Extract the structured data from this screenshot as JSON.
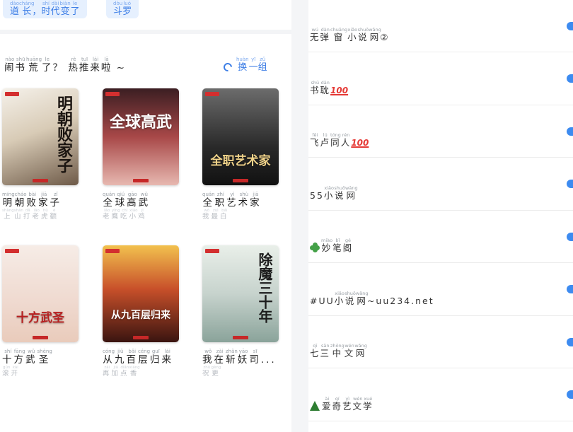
{
  "left": {
    "chips": [
      {
        "chars": [
          {
            "c": "道",
            "p": "dào"
          },
          {
            "c": "长",
            "p": "cháng"
          },
          {
            "c": "，",
            "p": ""
          },
          {
            "c": "时",
            "p": "shí"
          },
          {
            "c": "代",
            "p": "dài"
          },
          {
            "c": "变",
            "p": "biàn"
          },
          {
            "c": "了",
            "p": "le"
          }
        ]
      },
      {
        "chars": [
          {
            "c": "斗",
            "p": "dòu"
          },
          {
            "c": "罗",
            "p": "luó"
          }
        ]
      }
    ],
    "section_title": [
      {
        "c": "闹",
        "p": "nào"
      },
      {
        "c": "书",
        "p": "shū"
      },
      {
        "c": "荒",
        "p": "huāng"
      },
      {
        "c": "了",
        "p": "le"
      },
      {
        "c": "？",
        "p": ""
      },
      {
        "c": " ",
        "p": ""
      },
      {
        "c": "热",
        "p": "rè"
      },
      {
        "c": "推",
        "p": "tuī"
      },
      {
        "c": "来",
        "p": "lái"
      },
      {
        "c": "啦",
        "p": "lā"
      },
      {
        "c": " ~",
        "p": ""
      }
    ],
    "refresh": [
      {
        "c": "换",
        "p": "huàn"
      },
      {
        "c": "一",
        "p": "yī"
      },
      {
        "c": "组",
        "p": "zǔ"
      }
    ],
    "books": [
      {
        "name": [
          {
            "c": "明",
            "p": "míng"
          },
          {
            "c": "朝",
            "p": "cháo"
          },
          {
            "c": "败",
            "p": "bài"
          },
          {
            "c": "家",
            "p": "jiā"
          },
          {
            "c": "子",
            "p": "zǐ"
          }
        ],
        "author": [
          {
            "c": "上",
            "p": "shàng"
          },
          {
            "c": "山",
            "p": "shān"
          },
          {
            "c": "打",
            "p": "dǎ"
          },
          {
            "c": "老",
            "p": "lǎo"
          },
          {
            "c": "虎",
            "p": "hǔ"
          },
          {
            "c": "额",
            "p": "é"
          }
        ],
        "cover_text": "明朝败家子",
        "bg": "linear-gradient(160deg,#f5f1ea 0%,#d8cbb6 45%,#6e5a48 100%)",
        "fg": "#1a1410"
      },
      {
        "name": [
          {
            "c": "全",
            "p": "quán"
          },
          {
            "c": "球",
            "p": "qiú"
          },
          {
            "c": "高",
            "p": "gāo"
          },
          {
            "c": "武",
            "p": "wǔ"
          }
        ],
        "author": [
          {
            "c": "老",
            "p": "lǎo"
          },
          {
            "c": "鹰",
            "p": "yīng"
          },
          {
            "c": "吃",
            "p": "chī"
          },
          {
            "c": "小",
            "p": "xiǎo"
          },
          {
            "c": "鸡",
            "p": "jī"
          }
        ],
        "cover_text": "全球高武",
        "bg": "linear-gradient(180deg,#3b1e22 0%,#a84848 50%,#e7b8b0 100%)",
        "fg": "#ffffff"
      },
      {
        "name": [
          {
            "c": "全",
            "p": "quán"
          },
          {
            "c": "职",
            "p": "zhí"
          },
          {
            "c": "艺",
            "p": "yì"
          },
          {
            "c": "术",
            "p": "shù"
          },
          {
            "c": "家",
            "p": "jiā"
          }
        ],
        "author": [
          {
            "c": "我",
            "p": "wǒ"
          },
          {
            "c": "最",
            "p": "zuì"
          },
          {
            "c": "白",
            "p": "bái"
          }
        ],
        "cover_text": "全职艺术家",
        "bg": "linear-gradient(180deg,#6c6c6c 0%,#2a2a2a 60%,#111111 100%)",
        "fg": "#f2d48a"
      },
      {
        "name": [
          {
            "c": "十",
            "p": "shí"
          },
          {
            "c": "方",
            "p": "fāng"
          },
          {
            "c": "武",
            "p": "wǔ"
          },
          {
            "c": "圣",
            "p": "shèng"
          }
        ],
        "author": [
          {
            "c": "滚",
            "p": "gǔn"
          },
          {
            "c": "开",
            "p": "kāi"
          }
        ],
        "cover_text": "十方武圣",
        "bg": "linear-gradient(180deg,#f6ece6 0%,#efd9cf 60%,#e9cbbb 100%)",
        "fg": "#b81f1f"
      },
      {
        "name": [
          {
            "c": "从",
            "p": "cóng"
          },
          {
            "c": "九",
            "p": "jiǔ"
          },
          {
            "c": "百",
            "p": "bǎi"
          },
          {
            "c": "层",
            "p": "céng"
          },
          {
            "c": "归",
            "p": "guī"
          },
          {
            "c": "来",
            "p": "lái"
          }
        ],
        "author": [
          {
            "c": "再",
            "p": "zài"
          },
          {
            "c": "加",
            "p": "jiā"
          },
          {
            "c": "点",
            "p": "diǎn"
          },
          {
            "c": "香",
            "p": "xiāng"
          }
        ],
        "cover_text": "从九百层归来",
        "bg": "linear-gradient(180deg,#f2c14e 0%,#c8502a 45%,#3a1410 100%)",
        "fg": "#ffffff"
      },
      {
        "name": [
          {
            "c": "我",
            "p": "wǒ"
          },
          {
            "c": "在",
            "p": "zài"
          },
          {
            "c": "斩",
            "p": "zhǎn"
          },
          {
            "c": "妖",
            "p": "yāo"
          },
          {
            "c": "司",
            "p": "sī"
          },
          {
            "c": "...",
            "p": ""
          }
        ],
        "author": [
          {
            "c": "祝",
            "p": "zhù"
          },
          {
            "c": "更",
            "p": "gèng"
          }
        ],
        "cover_text": "除魔三十年",
        "bg": "linear-gradient(180deg,#e9efe9 0%,#c7d3cd 50%,#8aa39a 100%)",
        "fg": "#1c1c1c"
      }
    ]
  },
  "right": {
    "items": [
      {
        "chars": [
          {
            "c": "无",
            "p": "wú"
          },
          {
            "c": "弹",
            "p": "dàn"
          },
          {
            "c": "窗",
            "p": "chuāng"
          },
          {
            "c": "小",
            "p": "xiǎo"
          },
          {
            "c": "说",
            "p": "shuō"
          },
          {
            "c": "网",
            "p": "wǎng"
          },
          {
            "c": "②",
            "p": ""
          }
        ],
        "emoji": ""
      },
      {
        "chars": [
          {
            "c": "书",
            "p": "shū"
          },
          {
            "c": "耽",
            "p": "dān"
          }
        ],
        "emoji": "100"
      },
      {
        "chars": [
          {
            "c": "飞",
            "p": "fēi"
          },
          {
            "c": "卢",
            "p": "lú"
          },
          {
            "c": "同",
            "p": "tóng"
          },
          {
            "c": "人",
            "p": "rén"
          }
        ],
        "emoji": "100"
      },
      {
        "chars": [
          {
            "c": "55",
            "p": ""
          },
          {
            "c": "小",
            "p": "xiǎo"
          },
          {
            "c": "说",
            "p": "shuō"
          },
          {
            "c": "网",
            "p": "wǎng"
          }
        ],
        "emoji": ""
      },
      {
        "chars": [
          {
            "c": "妙",
            "p": "miào"
          },
          {
            "c": "笔",
            "p": "bǐ"
          },
          {
            "c": "阁",
            "p": "gé"
          }
        ],
        "emoji": "",
        "prefix": "clover"
      },
      {
        "chars": [
          {
            "c": "#UU",
            "p": ""
          },
          {
            "c": "小",
            "p": "xiǎo"
          },
          {
            "c": "说",
            "p": "shuō"
          },
          {
            "c": "网",
            "p": "wǎng"
          },
          {
            "c": "~uu234.net",
            "p": ""
          }
        ],
        "emoji": ""
      },
      {
        "chars": [
          {
            "c": "七",
            "p": "qī"
          },
          {
            "c": "三",
            "p": "sān"
          },
          {
            "c": "中",
            "p": "zhōng"
          },
          {
            "c": "文",
            "p": "wén"
          },
          {
            "c": "网",
            "p": "wǎng"
          }
        ],
        "emoji": ""
      },
      {
        "chars": [
          {
            "c": "爱",
            "p": "ài"
          },
          {
            "c": "奇",
            "p": "qí"
          },
          {
            "c": "艺",
            "p": "yì"
          },
          {
            "c": "文",
            "p": "wén"
          },
          {
            "c": "学",
            "p": "xué"
          }
        ],
        "emoji": "",
        "prefix": "tree"
      }
    ]
  }
}
